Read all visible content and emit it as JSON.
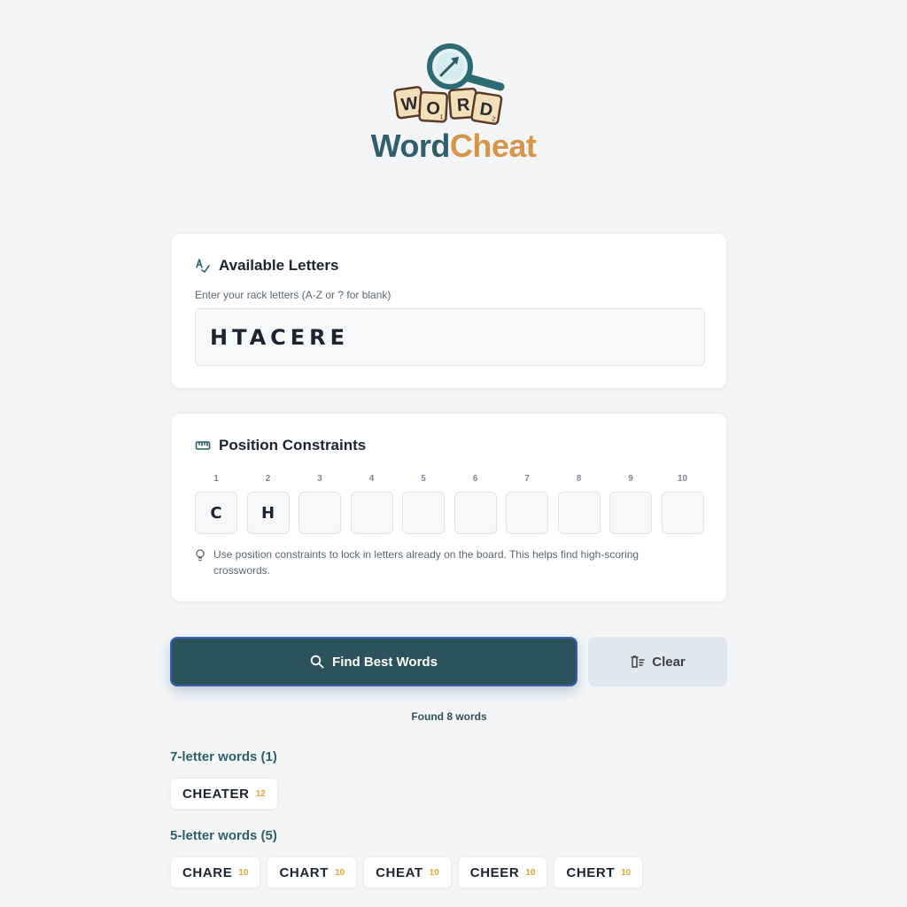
{
  "brand": {
    "part1": "Word",
    "part2": "Cheat",
    "tile_letters": [
      "W",
      "O",
      "R",
      "D"
    ],
    "tile_scores": [
      "4",
      "1",
      "1",
      "2"
    ]
  },
  "colors": {
    "primary": "#2c535c",
    "accent": "#d8954a",
    "score": "#e3a431"
  },
  "letters_card": {
    "title": "Available Letters",
    "icon": "handwriting-check-icon",
    "hint": "Enter your rack letters (A-Z or ? for blank)",
    "value": "HTACERE"
  },
  "positions_card": {
    "title": "Position Constraints",
    "icon": "ruler-icon",
    "positions": [
      {
        "num": "1",
        "letter": "C"
      },
      {
        "num": "2",
        "letter": "H"
      },
      {
        "num": "3",
        "letter": ""
      },
      {
        "num": "4",
        "letter": ""
      },
      {
        "num": "5",
        "letter": ""
      },
      {
        "num": "6",
        "letter": ""
      },
      {
        "num": "7",
        "letter": ""
      },
      {
        "num": "8",
        "letter": ""
      },
      {
        "num": "9",
        "letter": ""
      },
      {
        "num": "10",
        "letter": ""
      }
    ],
    "note": "Use position constraints to lock in letters already on the board. This helps find high-scoring crosswords."
  },
  "actions": {
    "find_label": "Find Best Words",
    "clear_label": "Clear"
  },
  "results": {
    "found_text": "Found 8 words",
    "groups": [
      {
        "title": "7-letter words (1)",
        "words": [
          {
            "word": "CHEATER",
            "score": "12"
          }
        ]
      },
      {
        "title": "5-letter words (5)",
        "words": [
          {
            "word": "CHARE",
            "score": "10"
          },
          {
            "word": "CHART",
            "score": "10"
          },
          {
            "word": "CHEAT",
            "score": "10"
          },
          {
            "word": "CHEER",
            "score": "10"
          },
          {
            "word": "CHERT",
            "score": "10"
          }
        ]
      }
    ]
  }
}
